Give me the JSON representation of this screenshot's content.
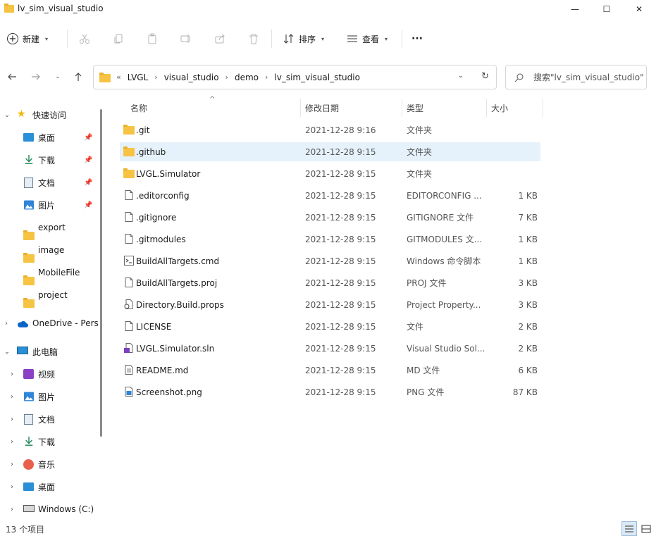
{
  "window": {
    "title": "lv_sim_visual_studio",
    "controls": {
      "minimize": "—",
      "maximize": "☐",
      "close": "✕"
    }
  },
  "toolbar": {
    "new_label": "新建",
    "sort_label": "排序",
    "view_label": "查看",
    "more_label": "···"
  },
  "nav": {
    "breadcrumbs": [
      "LVGL",
      "visual_studio",
      "demo",
      "lv_sim_visual_studio"
    ],
    "overflow": "«",
    "search_placeholder": "搜索\"lv_sim_visual_studio\""
  },
  "sidebar": {
    "quick_access": "快速访问",
    "pinned": [
      {
        "label": "桌面",
        "icon": "desktop-icon"
      },
      {
        "label": "下载",
        "icon": "download-icon"
      },
      {
        "label": "文档",
        "icon": "documents-icon"
      },
      {
        "label": "图片",
        "icon": "pictures-icon"
      }
    ],
    "folders": [
      "export",
      "image",
      "MobileFile",
      "project"
    ],
    "onedrive": "OneDrive - Pers",
    "this_pc": "此电脑",
    "pc_items": [
      {
        "label": "视频",
        "icon": "videos-icon"
      },
      {
        "label": "图片",
        "icon": "pictures-icon"
      },
      {
        "label": "文档",
        "icon": "documents-icon"
      },
      {
        "label": "下载",
        "icon": "download-icon"
      },
      {
        "label": "音乐",
        "icon": "music-icon"
      },
      {
        "label": "桌面",
        "icon": "desktop-icon"
      },
      {
        "label": "Windows (C:)",
        "icon": "drive-icon"
      }
    ]
  },
  "columns": {
    "name": "名称",
    "date": "修改日期",
    "type": "类型",
    "size": "大小"
  },
  "files": [
    {
      "name": ".git",
      "date": "2021-12-28 9:16",
      "type": "文件夹",
      "size": "",
      "kind": "folder"
    },
    {
      "name": ".github",
      "date": "2021-12-28 9:15",
      "type": "文件夹",
      "size": "",
      "kind": "folder",
      "selected": true
    },
    {
      "name": "LVGL.Simulator",
      "date": "2021-12-28 9:15",
      "type": "文件夹",
      "size": "",
      "kind": "folder"
    },
    {
      "name": ".editorconfig",
      "date": "2021-12-28 9:15",
      "type": "EDITORCONFIG ...",
      "size": "1 KB",
      "kind": "file"
    },
    {
      "name": ".gitignore",
      "date": "2021-12-28 9:15",
      "type": "GITIGNORE 文件",
      "size": "7 KB",
      "kind": "file"
    },
    {
      "name": ".gitmodules",
      "date": "2021-12-28 9:15",
      "type": "GITMODULES 文...",
      "size": "1 KB",
      "kind": "file"
    },
    {
      "name": "BuildAllTargets.cmd",
      "date": "2021-12-28 9:15",
      "type": "Windows 命令脚本",
      "size": "1 KB",
      "kind": "cmd"
    },
    {
      "name": "BuildAllTargets.proj",
      "date": "2021-12-28 9:15",
      "type": "PROJ 文件",
      "size": "3 KB",
      "kind": "file"
    },
    {
      "name": "Directory.Build.props",
      "date": "2021-12-28 9:15",
      "type": "Project Property...",
      "size": "3 KB",
      "kind": "props"
    },
    {
      "name": "LICENSE",
      "date": "2021-12-28 9:15",
      "type": "文件",
      "size": "2 KB",
      "kind": "file"
    },
    {
      "name": "LVGL.Simulator.sln",
      "date": "2021-12-28 9:15",
      "type": "Visual Studio Sol...",
      "size": "2 KB",
      "kind": "sln"
    },
    {
      "name": "README.md",
      "date": "2021-12-28 9:15",
      "type": "MD 文件",
      "size": "6 KB",
      "kind": "text"
    },
    {
      "name": "Screenshot.png",
      "date": "2021-12-28 9:15",
      "type": "PNG 文件",
      "size": "87 KB",
      "kind": "image"
    }
  ],
  "status": {
    "item_count": "13 个项目"
  },
  "colors": {
    "selection": "#e5f1fb",
    "folder": "#f6c343",
    "accent": "#0067c0"
  }
}
